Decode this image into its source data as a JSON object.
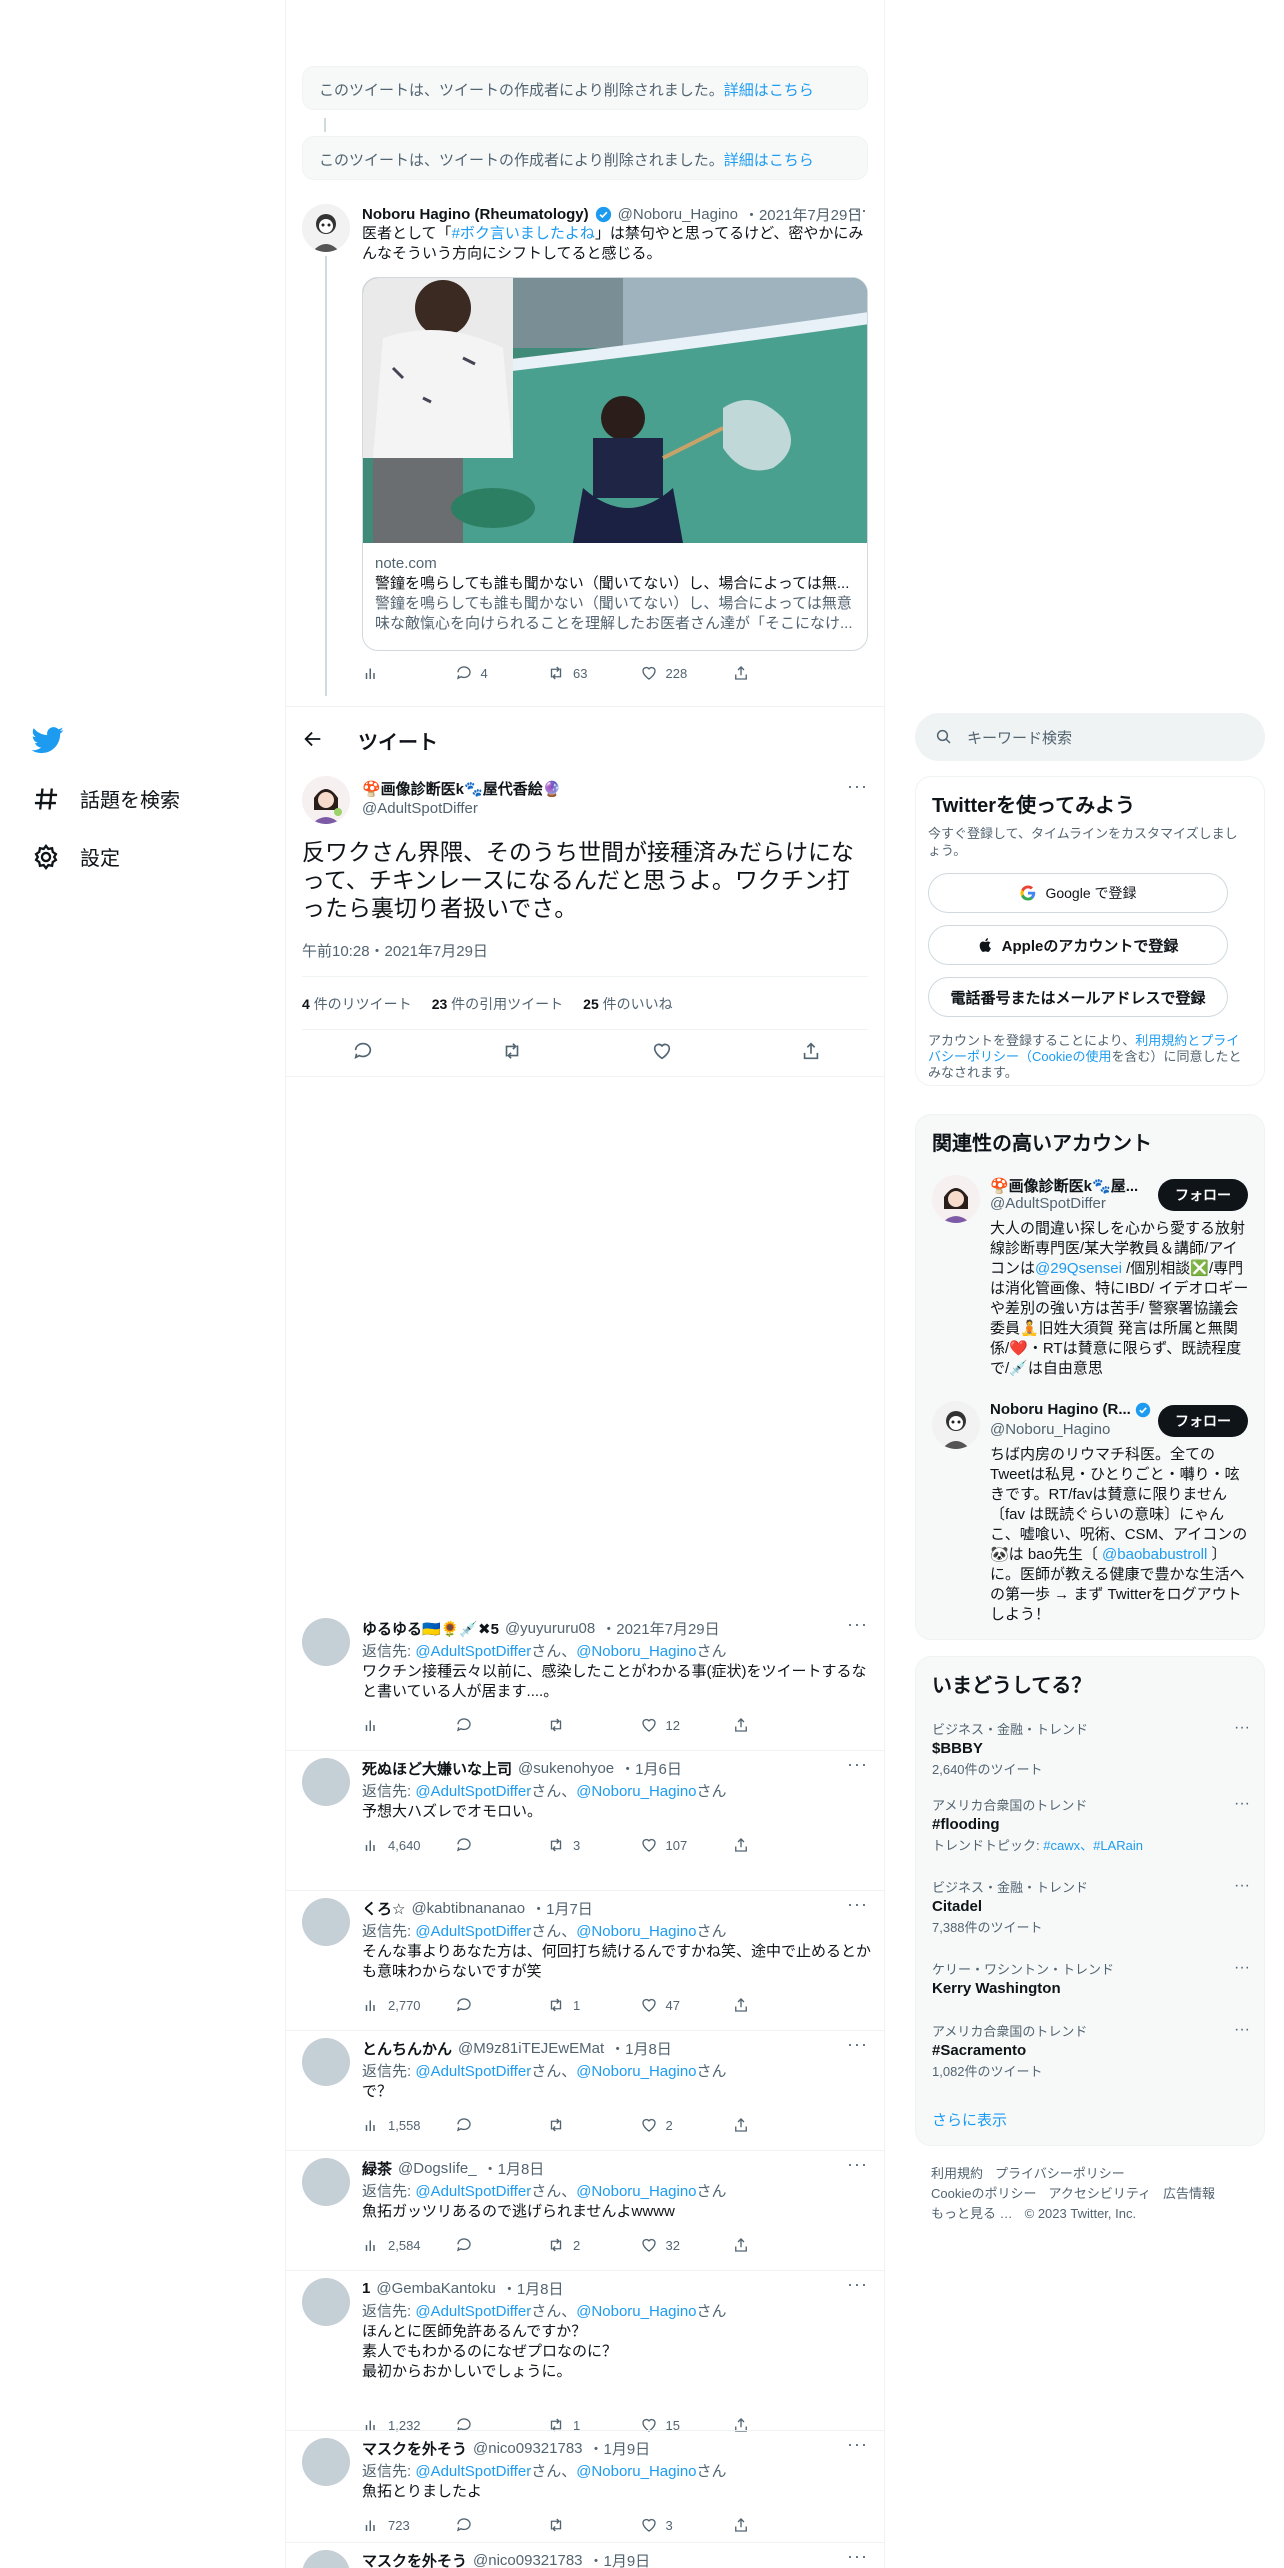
{
  "nav": {
    "explore_label": "話題を検索",
    "settings_label": "設定"
  },
  "deleted_notice": {
    "text": "このツイートは、ツイートの作成者により削除されました。",
    "link": "詳細はこちら"
  },
  "parent_tweet": {
    "name": "Noboru Hagino (Rheumatology)",
    "handle": "@Noboru_Hagino",
    "date": "・2021年7月29日",
    "text_pre": "医者として「",
    "hashtag": "#ボク言いましたよね",
    "text_post": "」は禁句やと思ってるけど、密やかにみんなそういう方向にシフトしてると感じる。",
    "card_domain": "note.com",
    "card_title": "警鐘を鳴らしても誰も聞かない（聞いてない）し、場合によっては無...",
    "card_desc": "警鐘を鳴らしても誰も聞かない（聞いてない）し、場合によっては無意味な敵愾心を向けられることを理解したお医者さん達が「そこになけ...",
    "replies": "4",
    "retweets": "63",
    "likes": "228"
  },
  "header": {
    "title": "ツイート"
  },
  "focused_tweet": {
    "name": "🍄画像診断医k🐾屋代香絵🔮",
    "handle": "@AdultSpotDiffer",
    "text": "反ワクさん界隈、そのうち世間が接種済みだらけになって、チキンレースになるんだと思うよ。ワクチン打ったら裏切り者扱いでさ。",
    "timestamp": "午前10:28・2021年7月29日",
    "retweets_count": "4",
    "retweets_label": "件のリツイート",
    "quotes_count": "23",
    "quotes_label": "件の引用ツイート",
    "likes_count": "25",
    "likes_label": "件のいいね"
  },
  "replies": [
    {
      "name": "ゆるゆる🇺🇦🌻💉✖5",
      "handle": "@yuyururu08",
      "date": "・2021年7月29日",
      "reply_prefix": "返信先: ",
      "reply_to1": "@AdultSpotDiffer",
      "reply_mid": "さん、",
      "reply_to2": "@Noboru_Hagino",
      "reply_suffix": "さん",
      "text": "ワクチン接種云々以前に、感染したことがわかる事(症状)をツイートするなと書いている人が居ます....。",
      "views": "",
      "replies": "",
      "retweets": "",
      "likes": "12"
    },
    {
      "name": "死ぬほど大嫌いな上司",
      "handle": "@sukenohyoe",
      "date": "・1月6日",
      "reply_prefix": "返信先: ",
      "reply_to1": "@AdultSpotDiffer",
      "reply_mid": "さん、",
      "reply_to2": "@Noboru_Hagino",
      "reply_suffix": "さん",
      "text": "予想大ハズレでオモロい。",
      "views": "4,640",
      "replies": "",
      "retweets": "3",
      "likes": "107"
    },
    {
      "name": "くろ☆",
      "handle": "@kabtibnananao",
      "date": "・1月7日",
      "reply_prefix": "返信先: ",
      "reply_to1": "@AdultSpotDiffer",
      "reply_mid": "さん、",
      "reply_to2": "@Noboru_Hagino",
      "reply_suffix": "さん",
      "text": "そんな事よりあなた方は、何回打ち続けるんですかね笑、途中で止めるとかも意味わからないですが笑",
      "views": "2,770",
      "replies": "",
      "retweets": "1",
      "likes": "47"
    },
    {
      "name": "とんちんかん",
      "handle": "@M9z81iTEJEwEMat",
      "date": "・1月8日",
      "reply_prefix": "返信先: ",
      "reply_to1": "@AdultSpotDiffer",
      "reply_mid": "さん、",
      "reply_to2": "@Noboru_Hagino",
      "reply_suffix": "さん",
      "text": "で？",
      "views": "1,558",
      "replies": "",
      "retweets": "",
      "likes": "2"
    },
    {
      "name": "緑茶",
      "handle": "@DogsIife_",
      "date": "・1月8日",
      "reply_prefix": "返信先: ",
      "reply_to1": "@AdultSpotDiffer",
      "reply_mid": "さん、",
      "reply_to2": "@Noboru_Hagino",
      "reply_suffix": "さん",
      "text": "魚拓ガッツリあるので逃げられませんよwwww",
      "views": "2,584",
      "replies": "",
      "retweets": "2",
      "likes": "32"
    },
    {
      "name": "1",
      "handle": "@GembaKantoku",
      "date": "・1月8日",
      "reply_prefix": "返信先: ",
      "reply_to1": "@AdultSpotDiffer",
      "reply_mid": "さん、",
      "reply_to2": "@Noboru_Hagino",
      "reply_suffix": "さん",
      "text": "ほんとに医師免許あるんですか？\n素人でもわかるのになぜプロなのに？\n最初からおかしいでしょうに。",
      "views": "1,232",
      "replies": "",
      "retweets": "1",
      "likes": "15"
    },
    {
      "name": "マスクを外そう",
      "handle": "@nico09321783",
      "date": "・1月9日",
      "reply_prefix": "返信先: ",
      "reply_to1": "@AdultSpotDiffer",
      "reply_mid": "さん、",
      "reply_to2": "@Noboru_Hagino",
      "reply_suffix": "さん",
      "text": "魚拓とりましたよ",
      "views": "723",
      "replies": "",
      "retweets": "",
      "likes": "3"
    },
    {
      "name": "マスクを外そう",
      "handle": "@nico09321783",
      "date": "・1月9日",
      "reply_prefix": "",
      "reply_to1": "",
      "reply_mid": "",
      "reply_to2": "",
      "reply_suffix": "",
      "text": "",
      "views": "",
      "replies": "",
      "retweets": "",
      "likes": ""
    }
  ],
  "search": {
    "placeholder": "キーワード検索"
  },
  "signup": {
    "title": "Twitterを使ってみよう",
    "subtitle": "今すぐ登録して、タイムラインをカスタマイズしましょう。",
    "google_label": "Google で登録",
    "apple_label": "Appleのアカウントで登録",
    "phone_label": "電話番号またはメールアドレスで登録",
    "terms_pre": "アカウントを登録することにより、",
    "terms_link": "利用規約とプライバシーポリシー（Cookieの使用",
    "terms_post": "を含む）に同意したとみなされます。"
  },
  "related": {
    "title": "関連性の高いアカウント",
    "accounts": [
      {
        "name": "🍄画像診断医k🐾屋...",
        "handle": "@AdultSpotDiffer",
        "follow_label": "フォロー",
        "bio_pre": "大人の間違い探しを心から愛する放射線診断専門医/某大学教員＆講師/アイコンは",
        "bio_link": "@29Qsensei",
        "bio_post": " /個別相談❎/専門は消化管画像、特にIBD/ イデオロギーや差別の強い方は苦手/ 警察署協議会委員🧘旧姓大須賀 発言は所属と無関係/❤️・RTは賛意に限らず、既読程度で/💉は自由意思"
      },
      {
        "name": "Noboru Hagino (R...",
        "handle": "@Noboru_Hagino",
        "follow_label": "フォロー",
        "bio_pre": "ちば内房のリウマチ科医。全てのTweetは私見・ひとりごと・囀り・呟きです。RT/favは賛意に限りません〔fav は既読ぐらいの意味〕にゃんこ、嘘喰い、呪術、CSM、アイコンの🐼は bao先生〔 ",
        "bio_link": "@baobabustroll",
        "bio_post": " 〕に。医師が教える健康で豊かな生活への第一歩 → まず Twitterをログアウトしよう！"
      }
    ]
  },
  "trends": {
    "title": "いまどうしてる？",
    "items": [
      {
        "category": "ビジネス・金融・トレンド",
        "name": "$BBBY",
        "sub": "2,640件のツイート",
        "topic_prefix": "",
        "topic_links": ""
      },
      {
        "category": "アメリカ合衆国のトレンド",
        "name": "#flooding",
        "sub": "",
        "topic_prefix": "トレンドトピック: ",
        "topic_links": "#cawx、#LARain"
      },
      {
        "category": "ビジネス・金融・トレンド",
        "name": "Citadel",
        "sub": "7,388件のツイート",
        "topic_prefix": "",
        "topic_links": ""
      },
      {
        "category": "ケリー・ワシントン・トレンド",
        "name": "Kerry Washington",
        "sub": "",
        "topic_prefix": "",
        "topic_links": ""
      },
      {
        "category": "アメリカ合衆国のトレンド",
        "name": "#Sacramento",
        "sub": "1,082件のツイート",
        "topic_prefix": "",
        "topic_links": ""
      }
    ],
    "show_more": "さらに表示"
  },
  "footer": {
    "terms": "利用規約",
    "privacy": "プライバシーポリシー",
    "cookie": "Cookieのポリシー",
    "accessibility": "アクセシビリティ",
    "ads": "広告情報",
    "more": "もっと見る …",
    "copyright": "© 2023 Twitter, Inc."
  },
  "colors": {
    "accent": "#1d9bf0",
    "text": "#0f1419",
    "secondary": "#536471",
    "border": "#eff3f4"
  }
}
